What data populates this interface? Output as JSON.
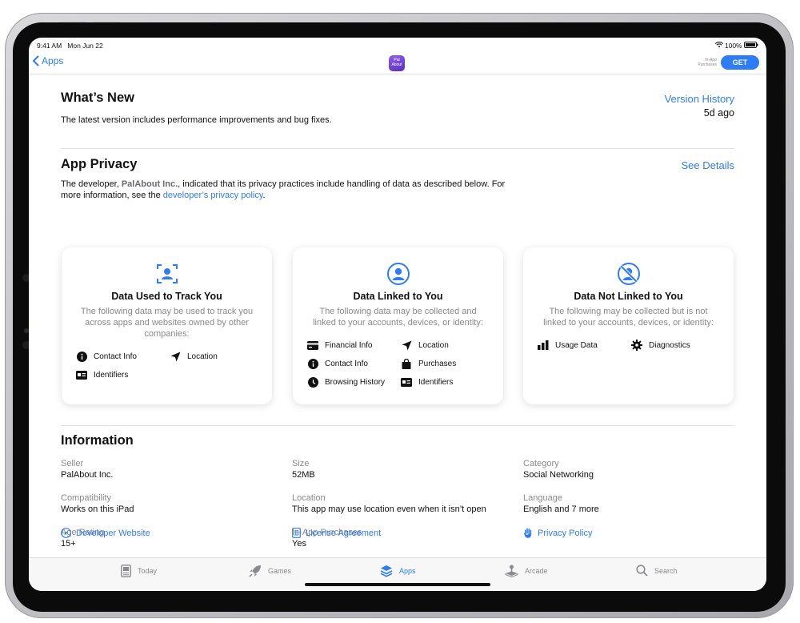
{
  "status_bar": {
    "time": "9:41 AM",
    "date": "Mon Jun 22",
    "battery": "100%"
  },
  "nav": {
    "back_label": "Apps",
    "app_icon_text": "Pal About",
    "in_app_note": "In-App Purchases",
    "get_label": "GET"
  },
  "whats_new": {
    "title": "What’s New",
    "version_history": "Version History",
    "age": "5d ago",
    "notes": "The latest version includes performance improvements and bug fixes."
  },
  "privacy": {
    "title": "App Privacy",
    "see_details": "See Details",
    "desc_before": "The developer, ",
    "developer": "PalAbout Inc.",
    "desc_middle": ", indicated that its privacy practices include handling of data as described below. For more information, see the ",
    "policy_link": "developer’s privacy policy",
    "desc_end": ".",
    "cards": [
      {
        "title": "Data Used to Track You",
        "description": "The following data may be used to track you across apps and websites owned by other companies:",
        "items": [
          "Contact Info",
          "Location",
          "Identifiers"
        ]
      },
      {
        "title": "Data Linked to You",
        "description": "The following data may be collected and linked to your accounts, devices, or identity:",
        "items": [
          "Financial Info",
          "Location",
          "Contact Info",
          "Purchases",
          "Browsing History",
          "Identifiers"
        ]
      },
      {
        "title": "Data Not Linked to You",
        "description": "The following may be collected but is not linked to your accounts, devices, or identity:",
        "items": [
          "Usage Data",
          "Diagnostics"
        ]
      }
    ]
  },
  "information": {
    "title": "Information",
    "fields": [
      {
        "label": "Seller",
        "value": "PalAbout Inc."
      },
      {
        "label": "Size",
        "value": "52MB"
      },
      {
        "label": "Category",
        "value": "Social Networking"
      },
      {
        "label": "Compatibility",
        "value": "Works on this iPad"
      },
      {
        "label": "Location",
        "value": "This app may use location even when it isn’t open"
      },
      {
        "label": "Language",
        "value": "English and 7 more"
      },
      {
        "label": "Age Rating",
        "value": "15+"
      },
      {
        "label": "In-App Purchases",
        "value": "Yes"
      }
    ],
    "links": [
      "Developer Website",
      "License Agreement",
      "Privacy Policy"
    ]
  },
  "tabs": [
    {
      "label": "Today",
      "icon": "today-icon"
    },
    {
      "label": "Games",
      "icon": "rocket-icon"
    },
    {
      "label": "Apps",
      "icon": "layers-icon"
    },
    {
      "label": "Arcade",
      "icon": "joystick-icon"
    },
    {
      "label": "Search",
      "icon": "search-icon"
    }
  ],
  "colors": {
    "accent": "#2e7cf6",
    "secondary_text": "#8a8a8e"
  }
}
